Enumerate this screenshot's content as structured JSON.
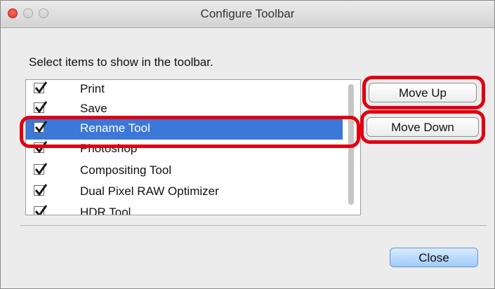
{
  "window": {
    "title": "Configure Toolbar",
    "instruction": "Select items to show in the toolbar."
  },
  "toolbar_items": [
    {
      "label": "Print",
      "checked": true,
      "selected": false
    },
    {
      "label": "Save",
      "checked": true,
      "selected": false
    },
    {
      "label": "Rename Tool",
      "checked": true,
      "selected": true
    },
    {
      "label": "Photoshop",
      "checked": true,
      "selected": false
    },
    {
      "label": "Compositing Tool",
      "checked": true,
      "selected": false
    },
    {
      "label": "Dual Pixel RAW Optimizer",
      "checked": true,
      "selected": false
    },
    {
      "label": "HDR Tool",
      "checked": true,
      "selected": false
    }
  ],
  "buttons": {
    "move_up": "Move Up",
    "move_down": "Move Down",
    "close": "Close"
  },
  "colors": {
    "selection": "#3b78d8",
    "annotation": "#e00012",
    "default_button": "#9fcbf7"
  }
}
